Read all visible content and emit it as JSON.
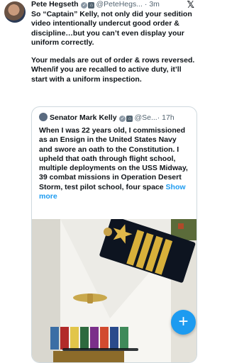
{
  "post": {
    "author_name": "Pete Hegseth",
    "handle": "@PeteHegs...",
    "time": "· 3m",
    "paragraphs": [
      "So “Captain” Kelly, not only did your sedition video intentionally undercut good order & discipline…but you can’t even display your uniform correctly.",
      "Your medals are out of order & rows reversed. When/if you are recalled to active duty, it’ll start with a uniform inspection."
    ]
  },
  "quote": {
    "author_name": "Senator Mark Kelly",
    "handle": "@Se...",
    "time": "· 17h",
    "text": "When I was 22 years old, I commissioned as an Ensign in the United States Navy and swore an oath to the Constitution. I upheld that oath through flight school, multiple deployments on the USS Midway, 39 combat missions in Operation Desert Storm, test pilot school, four space",
    "show_more": "Show more"
  },
  "icons": {
    "app": "x-logo-icon",
    "compose": "plus-icon",
    "verified": "gray-verified-badge-icon",
    "government": "government-badge-icon"
  },
  "colors": {
    "accent": "#1d9bf0",
    "text": "#0f1419",
    "secondary": "#536471",
    "border": "#cfd9de"
  }
}
